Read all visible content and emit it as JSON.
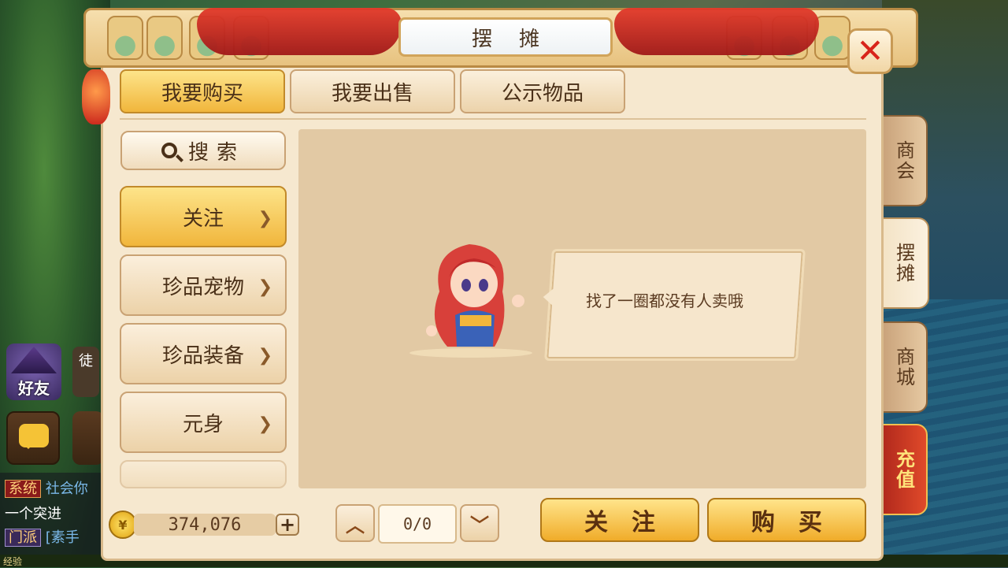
{
  "background": {
    "friend_label": "好友",
    "apprentice_label": "徒",
    "chat_lines": [
      {
        "tag": "系统",
        "text": "社会你"
      },
      {
        "tag": "",
        "text": "一个突进"
      },
      {
        "tag": "门派",
        "text": "[素手"
      }
    ],
    "exp_label": "经验"
  },
  "window": {
    "title": "摆摊",
    "close_icon": "close-icon"
  },
  "tabs": [
    {
      "label": "我要购买",
      "active": true
    },
    {
      "label": "我要出售",
      "active": false
    },
    {
      "label": "公示物品",
      "active": false
    }
  ],
  "side_tabs": [
    {
      "label": "商会"
    },
    {
      "label": "摆摊"
    },
    {
      "label": "商城"
    },
    {
      "label": "充值"
    }
  ],
  "search": {
    "label": "搜索"
  },
  "categories": [
    {
      "label": "关注"
    },
    {
      "label": "珍品宠物"
    },
    {
      "label": "珍品装备"
    },
    {
      "label": "元身"
    },
    {
      "label": ""
    }
  ],
  "content": {
    "empty_message": "找了一圈都没有人卖哦"
  },
  "footer": {
    "money": "374,076",
    "page": "0/0",
    "follow_button": "关注",
    "buy_button": "购买"
  },
  "colors": {
    "accent_gold": "#f1b63c",
    "panel_bg": "#f6e8cf",
    "close_red": "#d8241a",
    "recharge_red": "#c8281c"
  }
}
